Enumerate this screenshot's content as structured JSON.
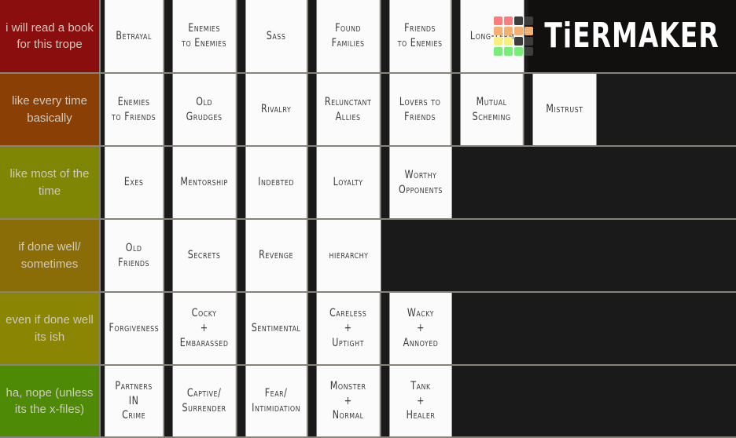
{
  "app": {
    "name": "TierMaker",
    "watermark_text": "TiERMAKER"
  },
  "colors": {
    "tier1": "#8B0E0E",
    "tier2": "#8A3F04",
    "tier3": "#7E8603",
    "tier4": "#8A6D06",
    "tier5": "#8A8503",
    "tier6": "#4E8A06",
    "background": "#1a1a1a",
    "border": "#87827a",
    "item_background": "#fbfbfb",
    "item_text": "#3a3a3a",
    "tier_label_text": "#cfc9bf",
    "watermark_background": "#120f0f",
    "watermark_text": "#ffffff"
  },
  "logo_grid": {
    "cells": [
      "#fb7c7c",
      "#fb7c7c",
      "#3d3d3d",
      "#3d3d3d",
      "#f4b072",
      "#f4b072",
      "#f4b072",
      "#f4b072",
      "#f7f07a",
      "#f7f07a",
      "#3d3d3d",
      "#3d3d3d",
      "#78ee78",
      "#78ee78",
      "#78ee78",
      "#3d3d3d"
    ]
  },
  "tiers": [
    {
      "id": "tier-1",
      "label": "i will read a book for this trope",
      "color": "#8B0E0E",
      "items": [
        "Betrayal",
        "Enemies\nto Enemies",
        "Sass",
        "Found\nFamilies",
        "Friends\nto Enemies",
        "Long-Term"
      ]
    },
    {
      "id": "tier-2",
      "label": "like every time basically",
      "color": "#8A3F04",
      "items": [
        "Enemies\nto Friends",
        "Old\nGrudges",
        "Rivalry",
        "Relunctant\nAllies",
        "Lovers to\nFriends",
        "Mutual\nScheming",
        "Mistrust"
      ]
    },
    {
      "id": "tier-3",
      "label": "like most of the time",
      "color": "#7E8603",
      "items": [
        "Exes",
        "Mentorship",
        "Indebted",
        "Loyalty",
        "Worthy\nOpponents"
      ]
    },
    {
      "id": "tier-4",
      "label": "if done well/ sometimes",
      "color": "#8A6D06",
      "items": [
        "Old\nFriends",
        "Secrets",
        "Revenge",
        "hierarchy"
      ]
    },
    {
      "id": "tier-5",
      "label": "even if done well its ish",
      "color": "#8A8503",
      "items": [
        "Forgiveness",
        "Cocky\n+\nEmbarassed",
        "Sentimental",
        "Careless\n+\nUptight",
        "Wacky\n+\nAnnoyed"
      ]
    },
    {
      "id": "tier-6",
      "label": "ha, nope (unless its the x-files)",
      "color": "#4E8A06",
      "items": [
        "Partners\nIN\nCrime",
        "Captive/\nSurrender",
        "Fear/\nIntimidation",
        "Monster\n+\nNormal",
        "Tank\n+\nHealer"
      ]
    }
  ]
}
